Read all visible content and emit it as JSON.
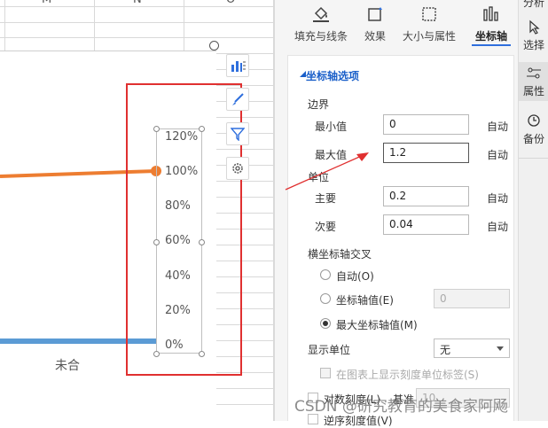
{
  "spreadsheet": {
    "column_headers": [
      "M",
      "N",
      "O"
    ],
    "category_label": "未合",
    "axis_ticks": [
      "120%",
      "100%",
      "80%",
      "60%",
      "40%",
      "20%",
      "0%"
    ]
  },
  "chart_tools": {
    "elements_button": "chart-elements",
    "style_button": "chart-style",
    "filter_button": "chart-filter",
    "settings_button": "chart-settings"
  },
  "panel": {
    "tabs": [
      {
        "label": "填充与线条",
        "icon": "paint-bucket-icon"
      },
      {
        "label": "效果",
        "icon": "effects-icon"
      },
      {
        "label": "大小与属性",
        "icon": "size-icon"
      },
      {
        "label": "坐标轴",
        "icon": "bar-axis-icon"
      }
    ],
    "section_title": "坐标轴选项",
    "bounds_label": "边界",
    "min_label": "最小值",
    "min_value": "0",
    "max_label": "最大值",
    "max_value": "1.2",
    "units_label": "单位",
    "major_label": "主要",
    "major_value": "0.2",
    "minor_label": "次要",
    "minor_value": "0.04",
    "auto_label": "自动",
    "cross_label": "横坐标轴交叉",
    "cross_auto": "自动(O)",
    "cross_value_label": "坐标轴值(E)",
    "cross_value": "0",
    "cross_max": "最大坐标轴值(M)",
    "display_unit_label": "显示单位",
    "display_unit_value": "无",
    "show_unit_label": "在图表上显示刻度单位标签(S)",
    "log_label": "对数刻度(L)",
    "log_base_label": "基准",
    "log_base_value": "10",
    "reverse_label": "逆序刻度值(V)"
  },
  "sidebar": {
    "top_label": "分析",
    "select_label": "选择",
    "properties_label": "属性",
    "backup_label": "备份"
  },
  "watermark": "CSDN @研究教育的美食家阿飏",
  "colors": {
    "orange_series": "#ed7d31",
    "blue_series": "#5b9bd5",
    "highlight": "#e03030",
    "accent": "#2f6fdd"
  }
}
